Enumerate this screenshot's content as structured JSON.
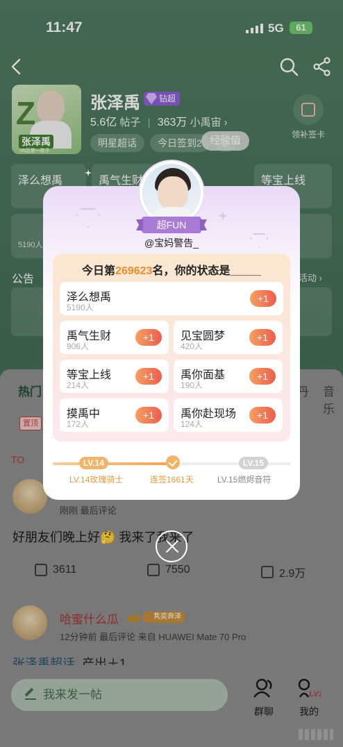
{
  "status_bar": {
    "time": "11:47",
    "network": "5G",
    "battery": "61"
  },
  "header": {
    "title": "张泽禹",
    "diamond_label": "钻超",
    "posts_count": "5.6亿",
    "posts_label": "帖子",
    "members_count": "363万",
    "members_label": "小禹宙",
    "chips": [
      "明星超话",
      "今日签到2",
      "2"
    ],
    "exp_label": "经验值",
    "signin_label": "领补签卡",
    "cover": {
      "big": "Z",
      "name": "张泽禹",
      "sub": "05后第一歌手"
    }
  },
  "bg_tasks": [
    "泽么想禹",
    "禹气生财",
    "圆梦",
    "等宝上线",
    "现场"
  ],
  "bg_counts": [
    "5190人",
    "+1",
    "+1"
  ],
  "notice": {
    "label": "公告",
    "more": "活动 ›"
  },
  "tabs": {
    "hot": "热门",
    "dan": "丹",
    "music": "音乐"
  },
  "pin_tag": "置顶",
  "top_label": "TO",
  "modal": {
    "badge": "超FUN",
    "handle": "@宝妈警告_",
    "rank_prefix": "今日第",
    "rank_number": "269623",
    "rank_suffix": "名，你的状态是_____",
    "tasks": [
      {
        "name": "泽么想禹",
        "count": "5190人",
        "plus": "+1"
      },
      {
        "name": "禹气生财",
        "count": "906人",
        "plus": "+1"
      },
      {
        "name": "见宝圆梦",
        "count": "420人",
        "plus": "+1"
      },
      {
        "name": "等宝上线",
        "count": "214人",
        "plus": "+1"
      },
      {
        "name": "禹你面基",
        "count": "190人",
        "plus": "+1"
      },
      {
        "name": "摸禹中",
        "count": "172人",
        "plus": "+1"
      },
      {
        "name": "禹你赴现场",
        "count": "124人",
        "plus": "+1"
      }
    ],
    "level": {
      "current_chip": "LV.14",
      "next_chip": "LV.15",
      "current_label": "LV.14玫瑰骑士",
      "streak_label": "连签1661天",
      "next_label": "LV.15燃烬音符",
      "progress": 0.52
    }
  },
  "posts": [
    {
      "meta": "刚刚  最后评论",
      "body": "好朋友们晚上好🤔 我来了我来了",
      "share": "3611",
      "comments": "7550",
      "likes": "2.9万"
    },
    {
      "name": "哈蜜什么瓜",
      "level": "8",
      "level_title": "隽奕奔泽",
      "meta": "12分钟前  最后评论   来自 HUAWEI Mate 70 Pro"
    }
  ],
  "source": {
    "tag": "张泽禹超话",
    "text": "产出＋1"
  },
  "bottom_bar": {
    "compose": "我来发一帖",
    "group_chat": "群聊",
    "mine": "我的",
    "lv_badge": "LV14"
  },
  "colors": {
    "accent": "#f2a14b",
    "plus_start": "#f4a062",
    "plus_end": "#ee5c4e",
    "rank_number": "#ef8b2c",
    "badge_purple": "#a77bd6"
  }
}
